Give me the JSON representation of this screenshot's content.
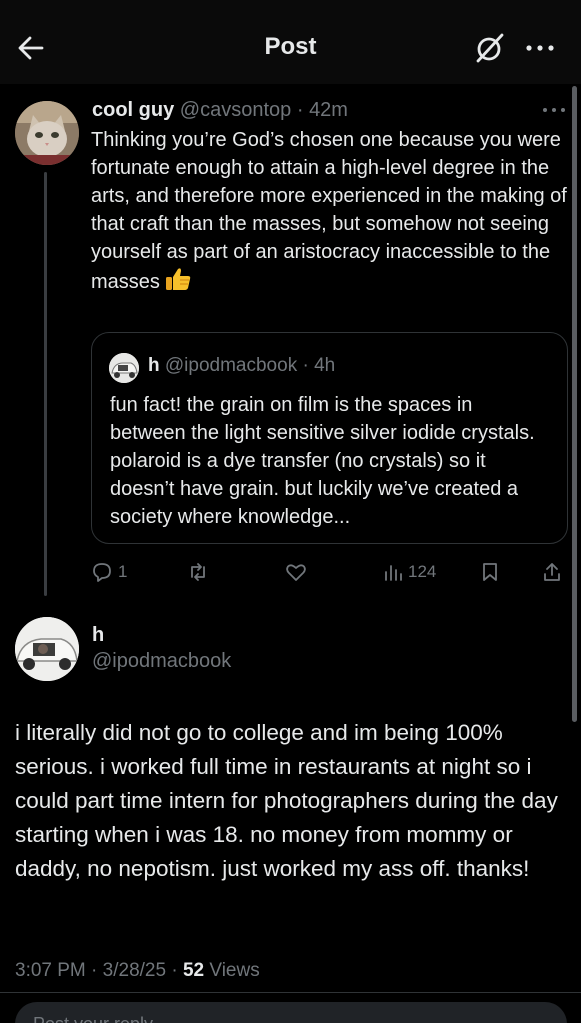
{
  "header": {
    "title": "Post",
    "icons": [
      "back-arrow-icon",
      "grok-icon",
      "more-icon"
    ]
  },
  "parent": {
    "name": "cool guy",
    "handle": "@cavsontop",
    "time": "42m",
    "text": "Thinking you’re God’s chosen one because you were fortunate enough to attain a high-level degree in the arts, and therefore more experienced in the making of that craft than the masses, but somehow not seeing yourself as part of an aristocracy inaccessible to the masses",
    "emoji": "thumbs-up-icon"
  },
  "quote": {
    "name": "h",
    "handle": "@ipodmacbook",
    "time": "4h",
    "text": "fun fact! the grain on film is the spaces in between the light sensitive silver iodide crystals. polaroid is a dye transfer (no crystals) so it doesn’t have grain. but luckily we’ve created a society where knowledge..."
  },
  "actions": {
    "replies": "1",
    "views": "124"
  },
  "reply": {
    "name": "h",
    "handle": "@ipodmacbook",
    "text": "i literally did not go to college and im being 100% serious. i worked full time in restaurants at night so i could part time intern for photographers during the day starting when i was 18. no money from mommy or daddy, no nepotism. just worked my ass off. thanks!",
    "time": "3:07 PM",
    "date": "3/28/25",
    "views_count": "52",
    "views_label": "Views"
  },
  "composer": {
    "placeholder": "Post your reply"
  },
  "colors": {
    "background": "#000000",
    "text": "#e7e9ea",
    "secondary": "#71767b",
    "border": "#2f3336"
  }
}
